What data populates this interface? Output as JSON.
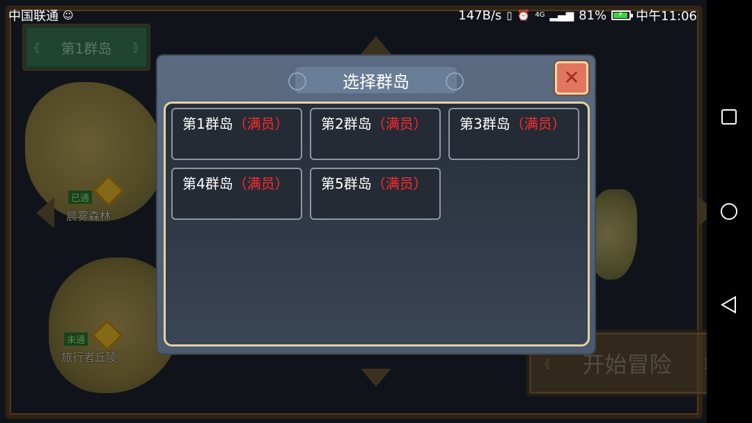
{
  "status_bar": {
    "carrier": "中国联通",
    "net_speed": "147B/s",
    "battery_pct": "81%",
    "battery_level": 0.81,
    "time": "中午11:06",
    "signal_tag": "4G",
    "icons": [
      "carrier-app-icon",
      "vibrate-icon",
      "alarm-icon",
      "signal-icon",
      "battery-icon"
    ]
  },
  "game": {
    "top_island_button": "第1群岛",
    "start_button": "开始冒险",
    "map_labels": [
      "晨雾森林",
      "旅行者丘陵"
    ],
    "map_badges": [
      "已通",
      "未通"
    ]
  },
  "dialog": {
    "title": "选择群岛",
    "close_icon": "close-icon",
    "islands": [
      {
        "name": "第1群岛",
        "status": "（满员）"
      },
      {
        "name": "第2群岛",
        "status": "（满员）"
      },
      {
        "name": "第3群岛",
        "status": "（满员）"
      },
      {
        "name": "第4群岛",
        "status": "（满员）"
      },
      {
        "name": "第5群岛",
        "status": "（满员）"
      }
    ]
  },
  "colors": {
    "status_full": "#ff2b2b",
    "panel_border": "#e6d3a5",
    "close_button": "#e2755e"
  }
}
